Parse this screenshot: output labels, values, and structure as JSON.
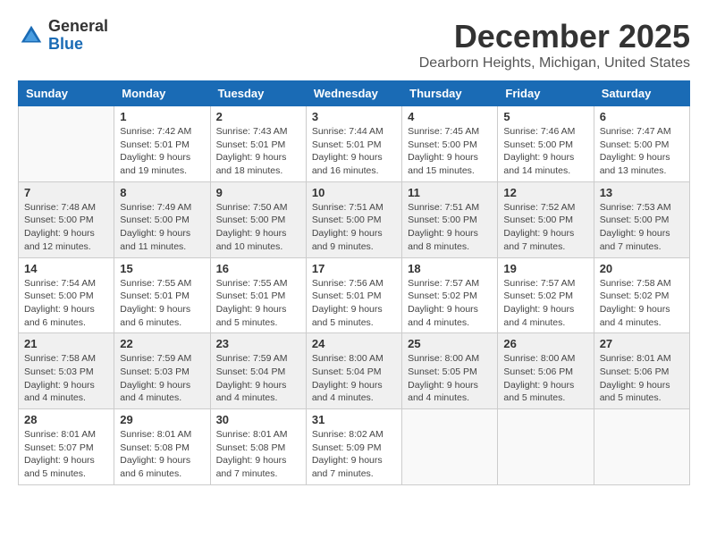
{
  "logo": {
    "general": "General",
    "blue": "Blue"
  },
  "header": {
    "month": "December 2025",
    "location": "Dearborn Heights, Michigan, United States"
  },
  "weekdays": [
    "Sunday",
    "Monday",
    "Tuesday",
    "Wednesday",
    "Thursday",
    "Friday",
    "Saturday"
  ],
  "weeks": [
    [
      {
        "day": "",
        "info": ""
      },
      {
        "day": "1",
        "info": "Sunrise: 7:42 AM\nSunset: 5:01 PM\nDaylight: 9 hours\nand 19 minutes."
      },
      {
        "day": "2",
        "info": "Sunrise: 7:43 AM\nSunset: 5:01 PM\nDaylight: 9 hours\nand 18 minutes."
      },
      {
        "day": "3",
        "info": "Sunrise: 7:44 AM\nSunset: 5:01 PM\nDaylight: 9 hours\nand 16 minutes."
      },
      {
        "day": "4",
        "info": "Sunrise: 7:45 AM\nSunset: 5:00 PM\nDaylight: 9 hours\nand 15 minutes."
      },
      {
        "day": "5",
        "info": "Sunrise: 7:46 AM\nSunset: 5:00 PM\nDaylight: 9 hours\nand 14 minutes."
      },
      {
        "day": "6",
        "info": "Sunrise: 7:47 AM\nSunset: 5:00 PM\nDaylight: 9 hours\nand 13 minutes."
      }
    ],
    [
      {
        "day": "7",
        "info": "Sunrise: 7:48 AM\nSunset: 5:00 PM\nDaylight: 9 hours\nand 12 minutes."
      },
      {
        "day": "8",
        "info": "Sunrise: 7:49 AM\nSunset: 5:00 PM\nDaylight: 9 hours\nand 11 minutes."
      },
      {
        "day": "9",
        "info": "Sunrise: 7:50 AM\nSunset: 5:00 PM\nDaylight: 9 hours\nand 10 minutes."
      },
      {
        "day": "10",
        "info": "Sunrise: 7:51 AM\nSunset: 5:00 PM\nDaylight: 9 hours\nand 9 minutes."
      },
      {
        "day": "11",
        "info": "Sunrise: 7:51 AM\nSunset: 5:00 PM\nDaylight: 9 hours\nand 8 minutes."
      },
      {
        "day": "12",
        "info": "Sunrise: 7:52 AM\nSunset: 5:00 PM\nDaylight: 9 hours\nand 7 minutes."
      },
      {
        "day": "13",
        "info": "Sunrise: 7:53 AM\nSunset: 5:00 PM\nDaylight: 9 hours\nand 7 minutes."
      }
    ],
    [
      {
        "day": "14",
        "info": "Sunrise: 7:54 AM\nSunset: 5:00 PM\nDaylight: 9 hours\nand 6 minutes."
      },
      {
        "day": "15",
        "info": "Sunrise: 7:55 AM\nSunset: 5:01 PM\nDaylight: 9 hours\nand 6 minutes."
      },
      {
        "day": "16",
        "info": "Sunrise: 7:55 AM\nSunset: 5:01 PM\nDaylight: 9 hours\nand 5 minutes."
      },
      {
        "day": "17",
        "info": "Sunrise: 7:56 AM\nSunset: 5:01 PM\nDaylight: 9 hours\nand 5 minutes."
      },
      {
        "day": "18",
        "info": "Sunrise: 7:57 AM\nSunset: 5:02 PM\nDaylight: 9 hours\nand 4 minutes."
      },
      {
        "day": "19",
        "info": "Sunrise: 7:57 AM\nSunset: 5:02 PM\nDaylight: 9 hours\nand 4 minutes."
      },
      {
        "day": "20",
        "info": "Sunrise: 7:58 AM\nSunset: 5:02 PM\nDaylight: 9 hours\nand 4 minutes."
      }
    ],
    [
      {
        "day": "21",
        "info": "Sunrise: 7:58 AM\nSunset: 5:03 PM\nDaylight: 9 hours\nand 4 minutes."
      },
      {
        "day": "22",
        "info": "Sunrise: 7:59 AM\nSunset: 5:03 PM\nDaylight: 9 hours\nand 4 minutes."
      },
      {
        "day": "23",
        "info": "Sunrise: 7:59 AM\nSunset: 5:04 PM\nDaylight: 9 hours\nand 4 minutes."
      },
      {
        "day": "24",
        "info": "Sunrise: 8:00 AM\nSunset: 5:04 PM\nDaylight: 9 hours\nand 4 minutes."
      },
      {
        "day": "25",
        "info": "Sunrise: 8:00 AM\nSunset: 5:05 PM\nDaylight: 9 hours\nand 4 minutes."
      },
      {
        "day": "26",
        "info": "Sunrise: 8:00 AM\nSunset: 5:06 PM\nDaylight: 9 hours\nand 5 minutes."
      },
      {
        "day": "27",
        "info": "Sunrise: 8:01 AM\nSunset: 5:06 PM\nDaylight: 9 hours\nand 5 minutes."
      }
    ],
    [
      {
        "day": "28",
        "info": "Sunrise: 8:01 AM\nSunset: 5:07 PM\nDaylight: 9 hours\nand 5 minutes."
      },
      {
        "day": "29",
        "info": "Sunrise: 8:01 AM\nSunset: 5:08 PM\nDaylight: 9 hours\nand 6 minutes."
      },
      {
        "day": "30",
        "info": "Sunrise: 8:01 AM\nSunset: 5:08 PM\nDaylight: 9 hours\nand 7 minutes."
      },
      {
        "day": "31",
        "info": "Sunrise: 8:02 AM\nSunset: 5:09 PM\nDaylight: 9 hours\nand 7 minutes."
      },
      {
        "day": "",
        "info": ""
      },
      {
        "day": "",
        "info": ""
      },
      {
        "day": "",
        "info": ""
      }
    ]
  ]
}
